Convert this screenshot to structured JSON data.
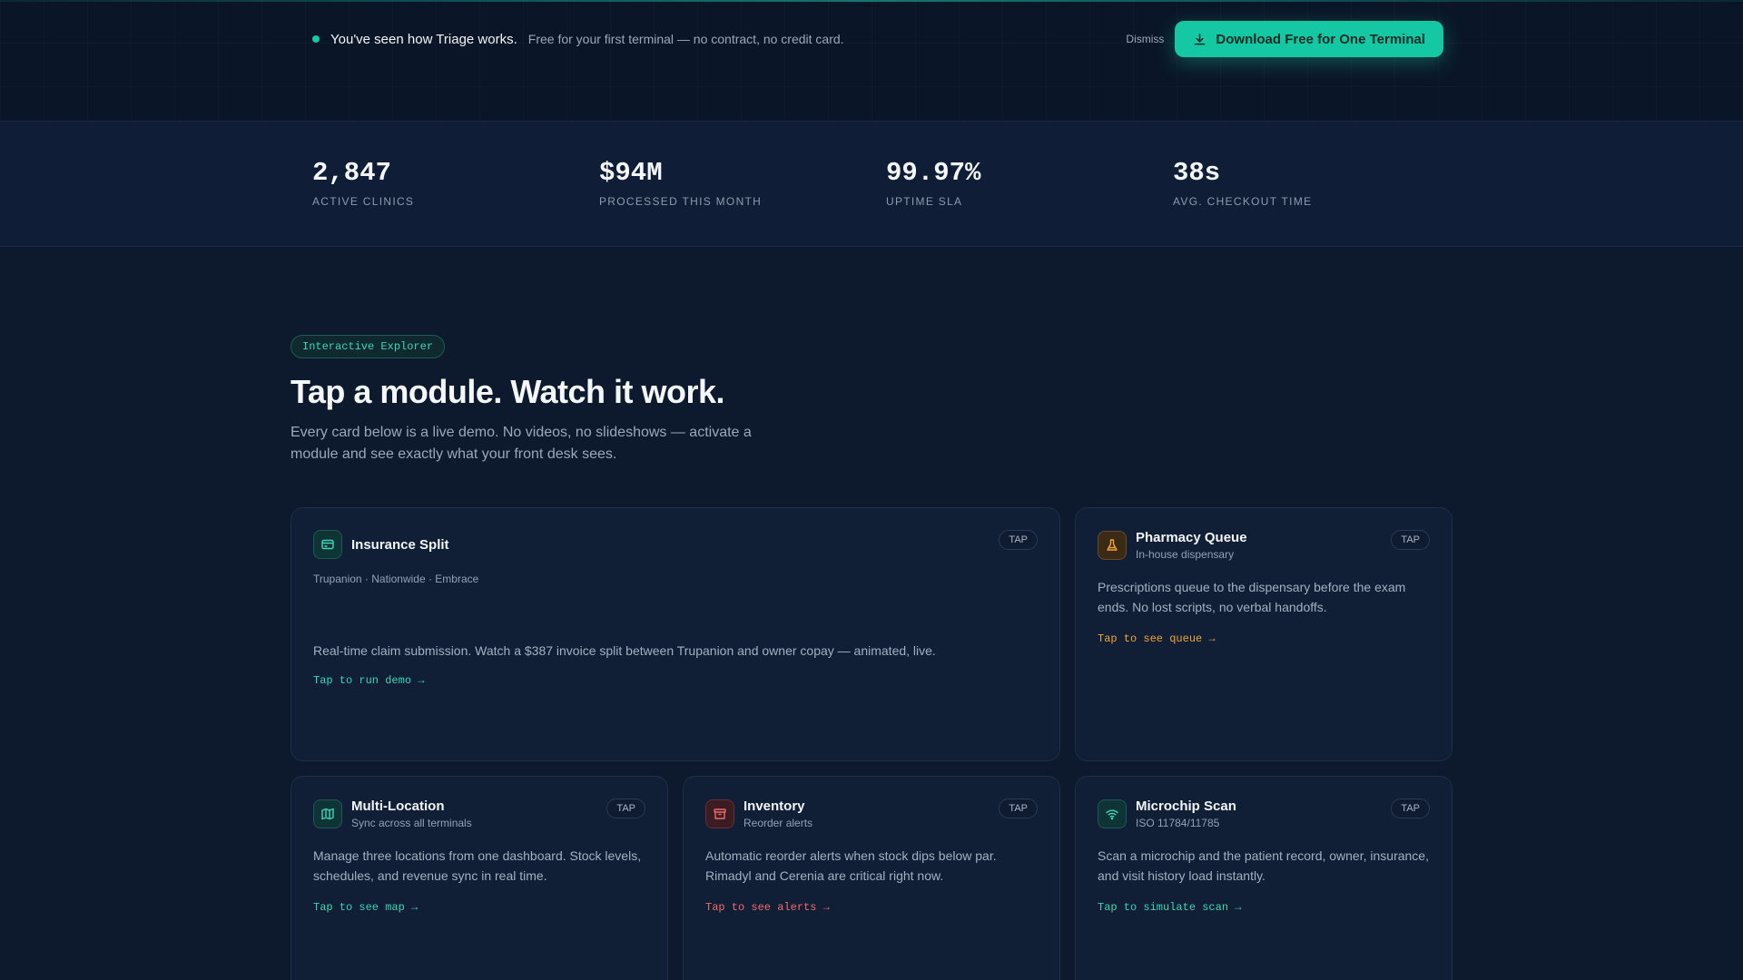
{
  "banner": {
    "headline": "You've seen how Triage works.",
    "subtext": "Free for your first terminal — no contract, no credit card.",
    "dismiss": "Dismiss",
    "download": "Download Free for One Terminal"
  },
  "stats": [
    {
      "value": "2,847",
      "label": "ACTIVE CLINICS"
    },
    {
      "value": "$94M",
      "label": "PROCESSED THIS MONTH"
    },
    {
      "value": "99.97%",
      "label": "UPTIME SLA"
    },
    {
      "value": "38s",
      "label": "AVG. CHECKOUT TIME"
    }
  ],
  "section": {
    "pill": "Interactive Explorer",
    "title": "Tap a module. Watch it work.",
    "subtitle": "Every card below is a live demo. No videos, no slideshows — activate a module and see exactly what your front desk sees."
  },
  "cards": {
    "tap": "TAP",
    "insurance": {
      "title": "Insurance Split",
      "sub": "Trupanion · Nationwide · Embrace",
      "desc": "Real-time claim submission. Watch a $387 invoice split between Trupanion and owner copay — animated, live.",
      "link": "Tap to run demo →"
    },
    "pharmacy": {
      "title": "Pharmacy Queue",
      "sub": "In-house dispensary",
      "desc": "Prescriptions queue to the dispensary before the exam ends. No lost scripts, no verbal handoffs.",
      "link": "Tap to see queue →"
    },
    "multilocation": {
      "title": "Multi-Location",
      "sub": "Sync across all terminals",
      "desc": "Manage three locations from one dashboard. Stock levels, schedules, and revenue sync in real time.",
      "link": "Tap to see map →"
    },
    "inventory": {
      "title": "Inventory",
      "sub": "Reorder alerts",
      "desc": "Automatic reorder alerts when stock dips below par. Rimadyl and Cerenia are critical right now.",
      "link": "Tap to see alerts →"
    },
    "microchip": {
      "title": "Microchip Scan",
      "sub": "ISO 11784/11785",
      "desc": "Scan a microchip and the patient record, owner, insurance, and visit history load instantly.",
      "link": "Tap to simulate scan →"
    }
  },
  "colors": {
    "accent": "#14c8a4",
    "amber": "#f0a53a",
    "red": "#f26b6b",
    "background": "#0d1a2e"
  }
}
